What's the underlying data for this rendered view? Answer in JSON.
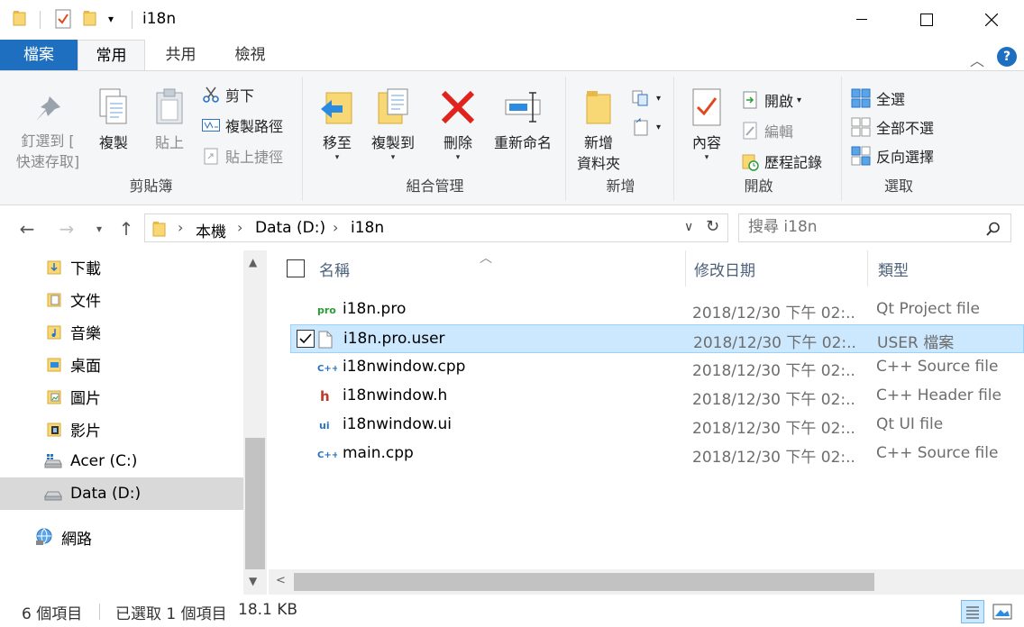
{
  "window": {
    "title": "i18n",
    "controls": [
      "minimize",
      "maximize",
      "close"
    ]
  },
  "ribbon_tabs": [
    {
      "label": "檔案",
      "active": false
    },
    {
      "label": "常用",
      "active": true
    },
    {
      "label": "共用",
      "active": false
    },
    {
      "label": "檢視",
      "active": false
    }
  ],
  "ribbon": {
    "clipboard": {
      "group_label": "剪貼簿",
      "pin_line1": "釘選到 [",
      "pin_line2": "快速存取]",
      "copy": "複製",
      "paste": "貼上",
      "cut": "剪下",
      "copy_path": "複製路徑",
      "paste_shortcut": "貼上捷徑"
    },
    "organize": {
      "group_label": "組合管理",
      "move_to": "移至",
      "copy_to": "複製到",
      "delete": "刪除",
      "rename": "重新命名"
    },
    "new": {
      "group_label": "新增",
      "new_folder_line1": "新增",
      "new_folder_line2": "資料夾"
    },
    "open": {
      "group_label": "開啟",
      "properties": "內容",
      "open": "開啟",
      "edit": "編輯",
      "history": "歷程記錄"
    },
    "select": {
      "group_label": "選取",
      "select_all": "全選",
      "select_none": "全部不選",
      "invert": "反向選擇"
    }
  },
  "address": {
    "crumbs": [
      "本機",
      "Data (D:)",
      "i18n"
    ],
    "search_placeholder": "搜尋 i18n"
  },
  "nav_pane": [
    {
      "label": "下載",
      "icon": "download-folder-icon"
    },
    {
      "label": "文件",
      "icon": "documents-folder-icon"
    },
    {
      "label": "音樂",
      "icon": "music-folder-icon"
    },
    {
      "label": "桌面",
      "icon": "desktop-folder-icon"
    },
    {
      "label": "圖片",
      "icon": "pictures-folder-icon"
    },
    {
      "label": "影片",
      "icon": "videos-folder-icon"
    },
    {
      "label": "Acer (C:)",
      "icon": "drive-icon"
    },
    {
      "label": "Data (D:)",
      "icon": "drive-icon",
      "selected": true
    },
    {
      "label": "網路",
      "icon": "network-icon"
    }
  ],
  "columns": {
    "name": "名稱",
    "date": "修改日期",
    "type": "類型"
  },
  "files": [
    {
      "name": "i18n.pro",
      "date": "2018/12/30 下午 02:...",
      "type": "Qt Project file",
      "icon": "pro"
    },
    {
      "name": "i18n.pro.user",
      "date": "2018/12/30 下午 02:...",
      "type": "USER 檔案",
      "icon": "blank",
      "selected": true
    },
    {
      "name": "i18nwindow.cpp",
      "date": "2018/12/30 下午 02:...",
      "type": "C++ Source file",
      "icon": "cpp"
    },
    {
      "name": "i18nwindow.h",
      "date": "2018/12/30 下午 02:...",
      "type": "C++ Header file",
      "icon": "h"
    },
    {
      "name": "i18nwindow.ui",
      "date": "2018/12/30 下午 02:...",
      "type": "Qt UI file",
      "icon": "ui"
    },
    {
      "name": "main.cpp",
      "date": "2018/12/30 下午 02:...",
      "type": "C++ Source file",
      "icon": "cpp"
    }
  ],
  "status": {
    "count": "6 個項目",
    "selected": "已選取 1 個項目",
    "size": "18.1 KB"
  },
  "colors": {
    "file_tab": "#1e6fbf",
    "selection": "#cce8ff",
    "folder": "#f8d775"
  }
}
